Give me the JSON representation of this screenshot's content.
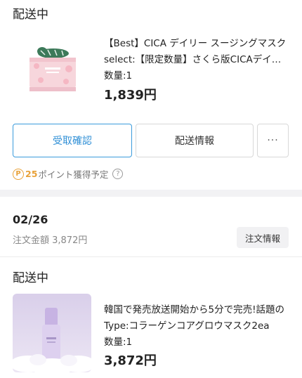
{
  "orders": [
    {
      "status": "配送中",
      "product_name": "【Best】CICA デイリー スージングマスク",
      "option": "select:【限定数量】さくら版CICAデイリー",
      "quantity": "数量:1",
      "price": "1,839円",
      "buttons": {
        "receive": "受取確認",
        "shipping": "配送情報",
        "more": "···"
      },
      "points": {
        "badge": "P",
        "amount": "25",
        "text": "ポイント獲得予定",
        "help": "?"
      }
    },
    {
      "date": "02/26",
      "total": "注文金額 3,872円",
      "order_info_button": "注文情報",
      "status": "配送中",
      "product_name": "韓国で発売放送開始から5分で完売!話題の",
      "option": "Type:コラーゲンコアグロウマスク2ea",
      "quantity": "数量:1",
      "price": "3,872円"
    }
  ],
  "colors": {
    "accent_blue": "#2f8fd6",
    "points_orange": "#e8a23a",
    "divider": "#f2f2f4"
  }
}
